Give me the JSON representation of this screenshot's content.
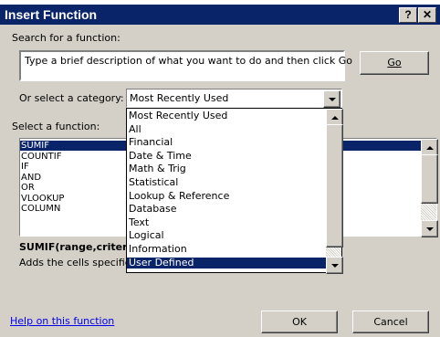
{
  "window": {
    "title": "Insert Function",
    "help_button": "?",
    "close_button": "✕"
  },
  "search": {
    "label": "Search for a function:",
    "value": "Type a brief description of what you want to do and then click Go",
    "go_button": "Go"
  },
  "category": {
    "label": "Or select a category:",
    "selected": "Most Recently Used",
    "options": [
      "Most Recently Used",
      "All",
      "Financial",
      "Date & Time",
      "Math & Trig",
      "Statistical",
      "Lookup & Reference",
      "Database",
      "Text",
      "Logical",
      "Information",
      "User Defined"
    ],
    "highlighted_option": "User Defined"
  },
  "functions": {
    "label": "Select a function:",
    "items": [
      "SUMIF",
      "COUNTIF",
      "IF",
      "AND",
      "OR",
      "VLOOKUP",
      "COLUMN"
    ],
    "selected": "SUMIF"
  },
  "description": {
    "signature": "SUMIF(range,criteri",
    "text": "Adds the cells specifie"
  },
  "footer": {
    "help_link": "Help on this function",
    "ok_button": "OK",
    "cancel_button": "Cancel"
  },
  "colors": {
    "titlebar": "#0a246a",
    "dialog_bg": "#d4d0c8",
    "selection": "#0a246a",
    "link": "#0000ee"
  }
}
